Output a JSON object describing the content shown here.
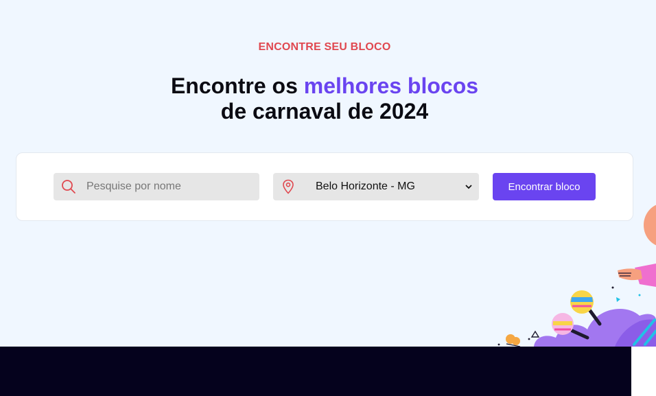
{
  "hero": {
    "eyebrow": "ENCONTRE SEU BLOCO",
    "headline_part1": "Encontre os ",
    "headline_accent": "melhores blocos",
    "headline_line2": "de carnaval de 2024"
  },
  "search": {
    "name_placeholder": "Pesquise por nome",
    "name_value": "",
    "city_selected": "Belo Horizonte - MG",
    "submit_label": "Encontrar bloco",
    "search_icon": "search-icon",
    "location_icon": "map-pin-icon",
    "dropdown_icon": "chevron-down-icon"
  },
  "colors": {
    "background": "#f0f7ff",
    "accent": "#6a44f0",
    "eyebrow": "#e0484f",
    "footer": "#05021d"
  }
}
